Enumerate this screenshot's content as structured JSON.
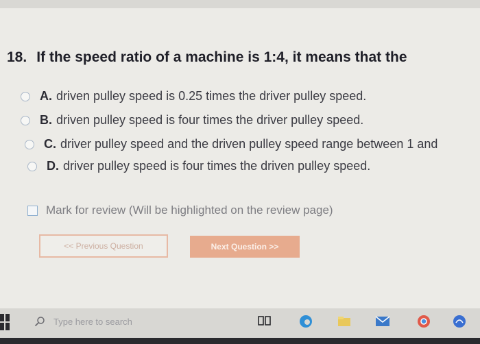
{
  "question": {
    "number": "18.",
    "text": "If the speed ratio of a machine is 1:4, it means that the"
  },
  "options": [
    {
      "letter": "A.",
      "text": "driven pulley speed is 0.25 times the driver pulley speed."
    },
    {
      "letter": "B.",
      "text": "driven pulley speed is four times the driver pulley speed."
    },
    {
      "letter": "C.",
      "text": "driver pulley speed and the driven pulley speed range between 1 and"
    },
    {
      "letter": "D.",
      "text": "driver pulley speed is four times the driven pulley speed."
    }
  ],
  "review": {
    "label": "Mark for review (Will be highlighted on the review page)"
  },
  "buttons": {
    "previous": "<< Previous Question",
    "next": "Next Question >>"
  },
  "taskbar": {
    "search_placeholder": "Type here to search"
  },
  "icons": {
    "start": "windows-start-icon",
    "search": "search-icon",
    "taskview": "task-view-icon",
    "edge": "edge-icon",
    "files": "file-explorer-icon",
    "mail": "mail-icon",
    "chrome": "chrome-icon",
    "store": "store-icon"
  },
  "colors": {
    "next_button": "#e7ab8e",
    "prev_border": "#e7b9a4",
    "radio_border": "#a9b7c8"
  }
}
